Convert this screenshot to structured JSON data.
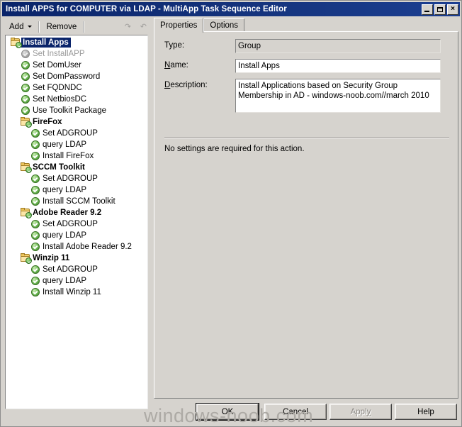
{
  "window": {
    "title": "Install APPS for COMPUTER via LDAP - MultiApp Task Sequence Editor",
    "minimize_label": "_",
    "maximize_label": "",
    "close_label": "×",
    "titlebar_color": "#0a246a",
    "face_color": "#d6d3ce"
  },
  "toolbar": {
    "add_label": "Add",
    "add_accel": "A",
    "remove_label": "Remove",
    "remove_accel": "R",
    "icon_move_up": "move-up-icon",
    "icon_move_down": "move-down-icon"
  },
  "tree": {
    "items": [
      {
        "label": "Install Apps",
        "icon": "folder-check-icon",
        "depth": 0,
        "bold": true,
        "selected": true,
        "disabled": false
      },
      {
        "label": "Set InstallAPP",
        "icon": "check-circle-icon",
        "depth": 1,
        "bold": false,
        "selected": false,
        "disabled": true
      },
      {
        "label": "Set DomUser",
        "icon": "check-circle-icon",
        "depth": 1,
        "bold": false,
        "selected": false,
        "disabled": false
      },
      {
        "label": "Set DomPassword",
        "icon": "check-circle-icon",
        "depth": 1,
        "bold": false,
        "selected": false,
        "disabled": false
      },
      {
        "label": "Set FQDNDC",
        "icon": "check-circle-icon",
        "depth": 1,
        "bold": false,
        "selected": false,
        "disabled": false
      },
      {
        "label": "Set NetbiosDC",
        "icon": "check-circle-icon",
        "depth": 1,
        "bold": false,
        "selected": false,
        "disabled": false
      },
      {
        "label": "Use Toolkit Package",
        "icon": "check-circle-icon",
        "depth": 1,
        "bold": false,
        "selected": false,
        "disabled": false
      },
      {
        "label": "FireFox",
        "icon": "folder-check-icon",
        "depth": 1,
        "bold": true,
        "selected": false,
        "disabled": false
      },
      {
        "label": "Set ADGROUP",
        "icon": "check-circle-icon",
        "depth": 2,
        "bold": false,
        "selected": false,
        "disabled": false
      },
      {
        "label": "query LDAP",
        "icon": "check-circle-icon",
        "depth": 2,
        "bold": false,
        "selected": false,
        "disabled": false
      },
      {
        "label": "Install FireFox",
        "icon": "check-circle-icon",
        "depth": 2,
        "bold": false,
        "selected": false,
        "disabled": false
      },
      {
        "label": "SCCM Toolkit",
        "icon": "folder-check-icon",
        "depth": 1,
        "bold": true,
        "selected": false,
        "disabled": false
      },
      {
        "label": "Set ADGROUP",
        "icon": "check-circle-icon",
        "depth": 2,
        "bold": false,
        "selected": false,
        "disabled": false
      },
      {
        "label": "query LDAP",
        "icon": "check-circle-icon",
        "depth": 2,
        "bold": false,
        "selected": false,
        "disabled": false
      },
      {
        "label": "Install SCCM Toolkit",
        "icon": "check-circle-icon",
        "depth": 2,
        "bold": false,
        "selected": false,
        "disabled": false
      },
      {
        "label": "Adobe Reader 9.2",
        "icon": "folder-check-icon",
        "depth": 1,
        "bold": true,
        "selected": false,
        "disabled": false
      },
      {
        "label": "Set ADGROUP",
        "icon": "check-circle-icon",
        "depth": 2,
        "bold": false,
        "selected": false,
        "disabled": false
      },
      {
        "label": "query LDAP",
        "icon": "check-circle-icon",
        "depth": 2,
        "bold": false,
        "selected": false,
        "disabled": false
      },
      {
        "label": "Install Adobe Reader 9.2",
        "icon": "check-circle-icon",
        "depth": 2,
        "bold": false,
        "selected": false,
        "disabled": false
      },
      {
        "label": "Winzip 11",
        "icon": "folder-check-icon",
        "depth": 1,
        "bold": true,
        "selected": false,
        "disabled": false
      },
      {
        "label": "Set ADGROUP",
        "icon": "check-circle-icon",
        "depth": 2,
        "bold": false,
        "selected": false,
        "disabled": false
      },
      {
        "label": "query LDAP",
        "icon": "check-circle-icon",
        "depth": 2,
        "bold": false,
        "selected": false,
        "disabled": false
      },
      {
        "label": "Install Winzip 11",
        "icon": "check-circle-icon",
        "depth": 2,
        "bold": false,
        "selected": false,
        "disabled": false
      }
    ]
  },
  "tabs": [
    {
      "label": "Properties",
      "active": true
    },
    {
      "label": "Options",
      "active": false
    }
  ],
  "properties": {
    "type_label": "Type:",
    "type_value": "Group",
    "name_label": "Name:",
    "name_accel": "N",
    "name_value": "Install Apps",
    "description_label": "Description:",
    "description_accel": "D",
    "description_value": "Install Applications based on Security Group\nMembership in AD - windows-noob.com//march 2010",
    "note": "No settings are required  for this action."
  },
  "buttons": {
    "ok": "OK",
    "cancel": "Cancel",
    "apply": "Apply",
    "apply_accel": "y",
    "help": "Help"
  },
  "watermark": "windows-noob.com"
}
